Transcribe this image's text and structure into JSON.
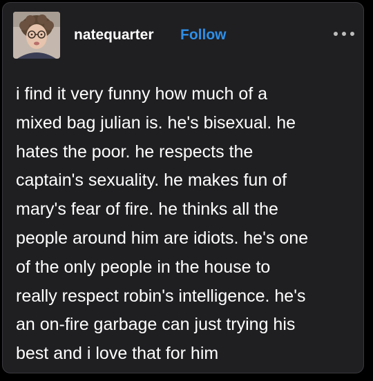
{
  "post": {
    "username": "natequarter",
    "follow_label": "Follow",
    "body_lines": [
      "i find it very funny how much of a",
      "mixed bag julian is. he's bisexual. he",
      "hates the poor. he respects the",
      "captain's sexuality. he makes fun of",
      "mary's fear of fire. he thinks all the",
      "people around him are idiots. he's one",
      "of the only people in the house to",
      "really respect robin's intelligence. he's",
      "an on-fire garbage can just trying his",
      "best and i love that for him"
    ]
  },
  "icons": {
    "avatar": "avatar-photo",
    "more": "more-options-icon"
  },
  "colors": {
    "background": "#000000",
    "card": "#1f1f22",
    "text": "#ffffff",
    "follow": "#2e8fe8"
  }
}
